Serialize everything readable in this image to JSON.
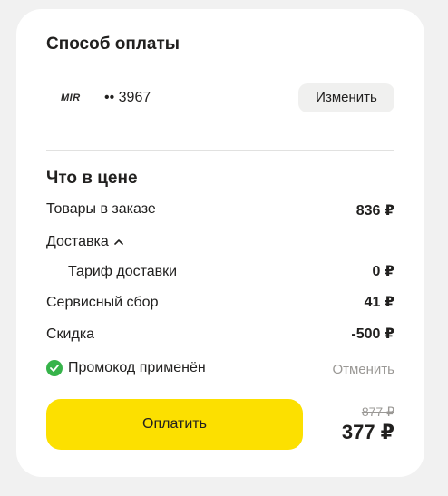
{
  "payment": {
    "title": "Способ оплаты",
    "card_brand": "MIR",
    "card_mask": "•• 3967",
    "change_label": "Изменить"
  },
  "price": {
    "title": "Что в цене",
    "goods_label": "Товары в заказе",
    "goods_value": "836 ₽",
    "delivery_label": "Доставка",
    "tariff_label": "Тариф доставки",
    "tariff_value": "0 ₽",
    "service_label": "Сервисный сбор",
    "service_value": "41 ₽",
    "discount_label": "Скидка",
    "discount_value": "-500 ₽"
  },
  "promo": {
    "status": "Промокод применён",
    "cancel_label": "Отменить"
  },
  "checkout": {
    "pay_label": "Оплатить",
    "old_total": "877 ₽",
    "total": "377 ₽"
  },
  "colors": {
    "accent": "#fce000",
    "success": "#36b34a"
  }
}
